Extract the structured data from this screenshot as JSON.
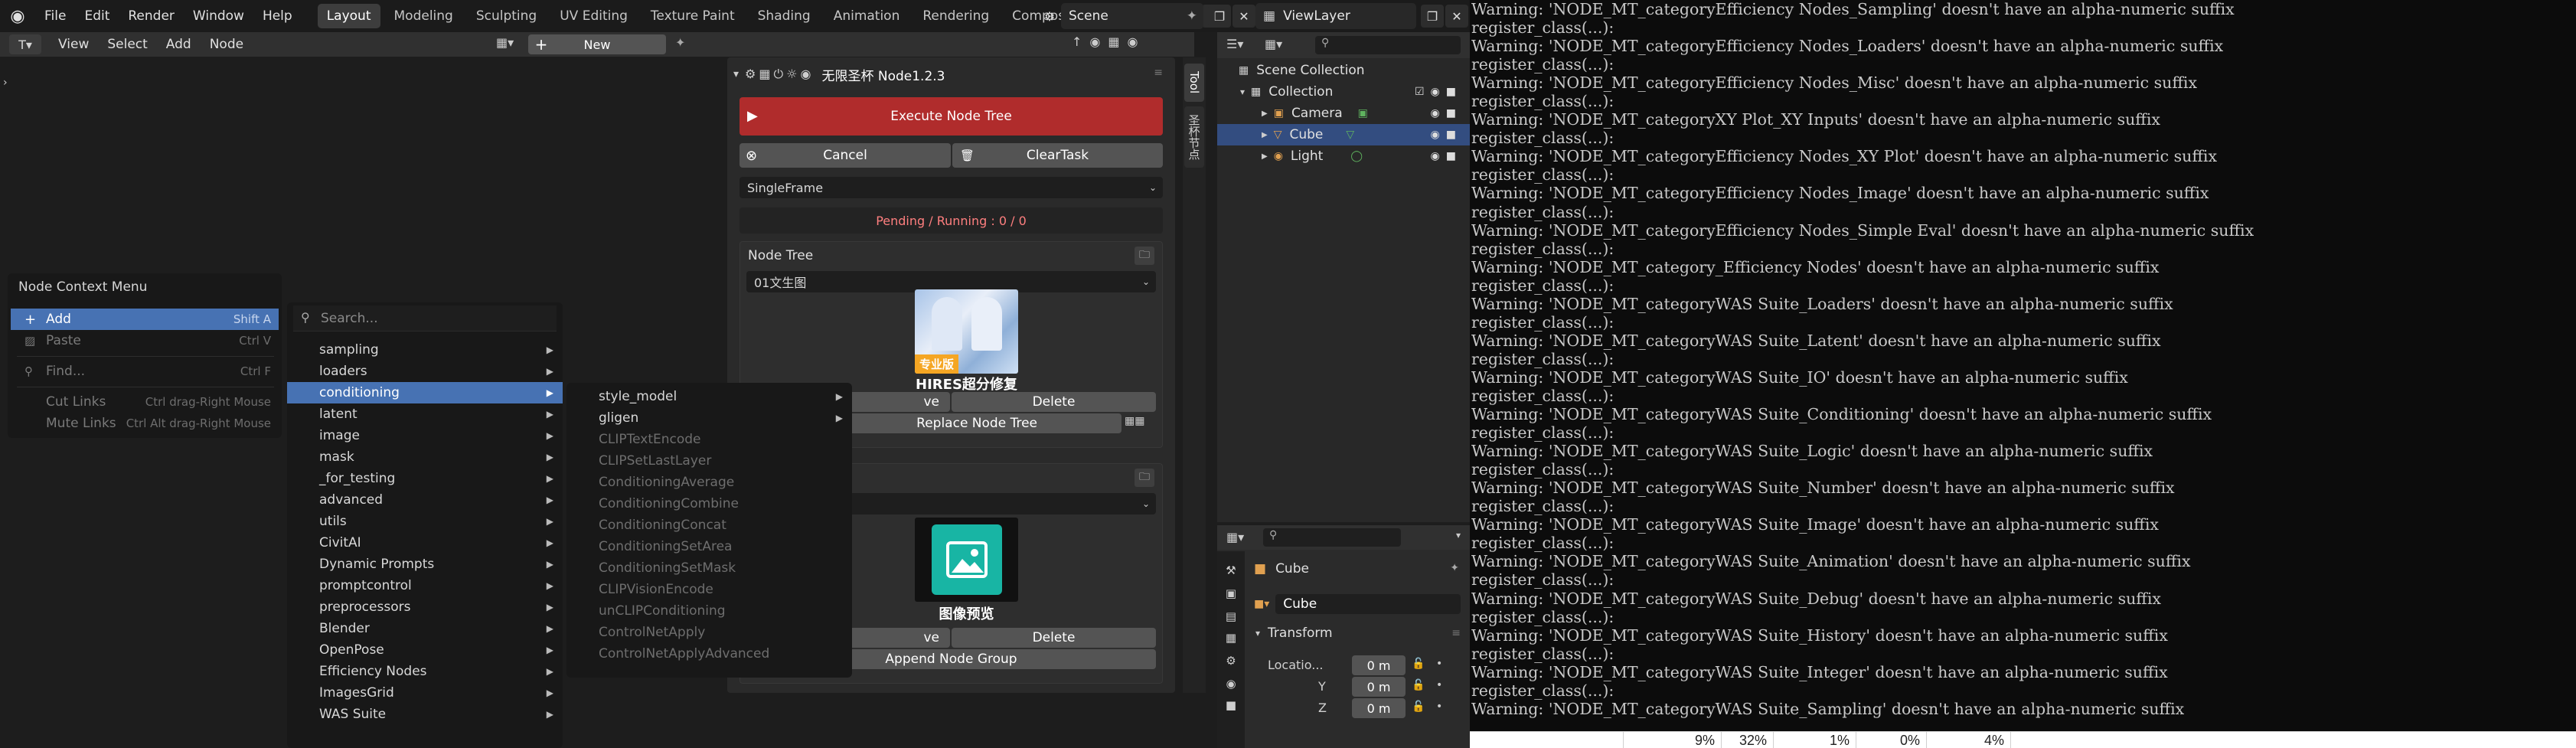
{
  "topbar": {
    "menus": [
      "File",
      "Edit",
      "Render",
      "Window",
      "Help"
    ],
    "workspaces": [
      "Layout",
      "Modeling",
      "Sculpting",
      "UV Editing",
      "Texture Paint",
      "Shading",
      "Animation",
      "Rendering",
      "Compositi"
    ],
    "active_workspace": "Layout",
    "scene_name": "Scene",
    "view_layer": "ViewLayer"
  },
  "node_editor": {
    "menus": [
      "View",
      "Select",
      "Add",
      "Node"
    ],
    "new_label": "New"
  },
  "context_menu": {
    "title": "Node Context Menu",
    "items": [
      {
        "label": "Add",
        "shortcut": "Shift A"
      },
      {
        "label": "Paste",
        "shortcut": "Ctrl V"
      },
      {
        "label": "Find...",
        "shortcut": "Ctrl F"
      },
      {
        "label": "Cut Links",
        "shortcut": "Ctrl drag-Right Mouse"
      },
      {
        "label": "Mute Links",
        "shortcut": "Ctrl Alt drag-Right Mouse"
      }
    ]
  },
  "add_menu": {
    "search_placeholder": "Search...",
    "items": [
      "sampling",
      "loaders",
      "conditioning",
      "latent",
      "image",
      "mask",
      "_for_testing",
      "advanced",
      "utils",
      "CivitAI",
      "Dynamic Prompts",
      "promptcontrol",
      "preprocessors",
      "Blender",
      "OpenPose",
      "Efficiency Nodes",
      "ImagesGrid",
      "WAS Suite"
    ]
  },
  "conditioning_menu": {
    "items": [
      "style_model",
      "gligen",
      "CLIPTextEncode",
      "CLIPSetLastLayer",
      "ConditioningAverage",
      "ConditioningCombine",
      "ConditioningConcat",
      "ConditioningSetArea",
      "ConditioningSetMask",
      "CLIPVisionEncode",
      "unCLIPConditioning",
      "ControlNetApply",
      "ControlNetApplyAdvanced"
    ]
  },
  "plugin": {
    "title": "无限圣杯 Node1.2.3",
    "execute": "Execute Node Tree",
    "cancel": "Cancel",
    "clear_task": "ClearTask",
    "mode": "SingleFrame",
    "pending": "Pending / Running : 0 / 0",
    "node_tree_title": "Node Tree",
    "tree_select": "01文生图",
    "thumb1_badge": "专业版",
    "thumb1_caption": "HIRES超分修复",
    "save_partial": "ve",
    "delete": "Delete",
    "replace": "Replace Node Tree",
    "thumb2_caption": "图像预览",
    "append": "Append Node Group"
  },
  "sidebar_tabs": [
    "Tool",
    "圣杯节点"
  ],
  "outliner": {
    "rows": [
      {
        "label": "Scene Collection"
      },
      {
        "label": "Collection"
      },
      {
        "label": "Camera"
      },
      {
        "label": "Cube"
      },
      {
        "label": "Light"
      }
    ]
  },
  "properties": {
    "object_name": "Cube",
    "data_name": "Cube",
    "transform": "Transform",
    "location_label": "Locatio...",
    "y_label": "Y",
    "z_label": "Z",
    "x_value": "0 m",
    "y_value": "0 m",
    "z_value": "0 m"
  },
  "console": {
    "lines": [
      "Warning: 'NODE_MT_categoryEfficiency Nodes_Sampling' doesn't have an alpha-numeric suffix",
      "register_class(...):",
      "Warning: 'NODE_MT_categoryEfficiency Nodes_Loaders' doesn't have an alpha-numeric suffix",
      "register_class(...):",
      "Warning: 'NODE_MT_categoryEfficiency Nodes_Misc' doesn't have an alpha-numeric suffix",
      "register_class(...):",
      "Warning: 'NODE_MT_categoryXY Plot_XY Inputs' doesn't have an alpha-numeric suffix",
      "register_class(...):",
      "Warning: 'NODE_MT_categoryEfficiency Nodes_XY Plot' doesn't have an alpha-numeric suffix",
      "register_class(...):",
      "Warning: 'NODE_MT_categoryEfficiency Nodes_Image' doesn't have an alpha-numeric suffix",
      "register_class(...):",
      "Warning: 'NODE_MT_categoryEfficiency Nodes_Simple Eval' doesn't have an alpha-numeric suffix",
      "register_class(...):",
      "Warning: 'NODE_MT_category_Efficiency Nodes' doesn't have an alpha-numeric suffix",
      "register_class(...):",
      "Warning: 'NODE_MT_categoryWAS Suite_Loaders' doesn't have an alpha-numeric suffix",
      "register_class(...):",
      "Warning: 'NODE_MT_categoryWAS Suite_Latent' doesn't have an alpha-numeric suffix",
      "register_class(...):",
      "Warning: 'NODE_MT_categoryWAS Suite_IO' doesn't have an alpha-numeric suffix",
      "register_class(...):",
      "Warning: 'NODE_MT_categoryWAS Suite_Conditioning' doesn't have an alpha-numeric suffix",
      "register_class(...):",
      "Warning: 'NODE_MT_categoryWAS Suite_Logic' doesn't have an alpha-numeric suffix",
      "register_class(...):",
      "Warning: 'NODE_MT_categoryWAS Suite_Number' doesn't have an alpha-numeric suffix",
      "register_class(...):",
      "Warning: 'NODE_MT_categoryWAS Suite_Image' doesn't have an alpha-numeric suffix",
      "register_class(...):",
      "Warning: 'NODE_MT_categoryWAS Suite_Animation' doesn't have an alpha-numeric suffix",
      "register_class(...):",
      "Warning: 'NODE_MT_categoryWAS Suite_Debug' doesn't have an alpha-numeric suffix",
      "register_class(...):",
      "Warning: 'NODE_MT_categoryWAS Suite_History' doesn't have an alpha-numeric suffix",
      "register_class(...):",
      "Warning: 'NODE_MT_categoryWAS Suite_Integer' doesn't have an alpha-numeric suffix",
      "register_class(...):",
      "Warning: 'NODE_MT_categoryWAS Suite_Sampling' doesn't have an alpha-numeric suffix"
    ]
  },
  "spreadsheet": {
    "cells": [
      "9%",
      "32%",
      "1%",
      "0%",
      "4%"
    ]
  }
}
